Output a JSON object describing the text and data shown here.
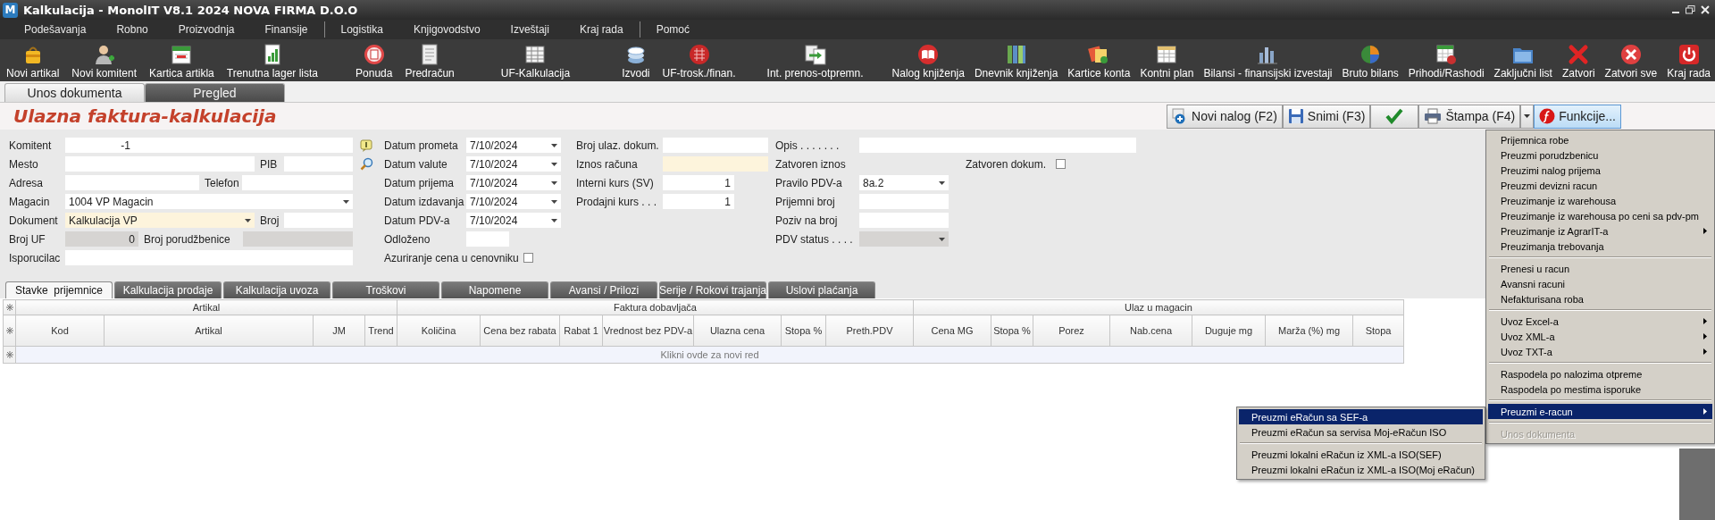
{
  "window": {
    "logo_text": "M",
    "title": "Kalkulacija - MonolIT V8.1 2024 NOVA FIRMA D.O.O"
  },
  "menu_groups": [
    [
      "Podešavanja",
      "Robno",
      "Proizvodnja",
      "Finansije"
    ],
    [
      "Logistika",
      "Knjigovodstvo",
      "Izveštaji",
      "Kraj rada"
    ],
    [
      "Pomoć"
    ]
  ],
  "toolbar": [
    "Novi artikal",
    "Novi komitent",
    "Kartica artikla",
    "Trenutna lager lista",
    "Ponuda",
    "Predračun",
    "UF-Kalkulacija",
    "Izvodi",
    "UF-trosk./finan.",
    "Int. prenos-otpremn.",
    "Nalog knjiženja",
    "Dnevnik knjiženja",
    "Kartice konta",
    "Kontni plan",
    "Bilansi - finansijski izvestaji",
    "Bruto bilans",
    "Prihodi/Rashodi",
    "Zaključni list",
    "Zatvori",
    "Zatvori sve",
    "Kraj rada"
  ],
  "main_tabs": [
    {
      "label": "Unos dokumenta",
      "selected": true
    },
    {
      "label": "Pregled",
      "selected": false
    }
  ],
  "page_title": "Ulazna faktura-kalkulacija",
  "actions": [
    {
      "kind": "plus",
      "label": "Novi nalog (F2)",
      "pressed": false
    },
    {
      "kind": "save",
      "label": "Snimi (F3)",
      "pressed": false
    },
    {
      "kind": "check",
      "pressed": false
    },
    {
      "kind": "print",
      "label": "Štampa (F4)",
      "pressed": false
    },
    {
      "kind": "dropdown",
      "pressed": false
    },
    {
      "kind": "function",
      "label": "Funkcije...",
      "pressed": true
    }
  ],
  "form": {
    "columns": [
      {
        "rows": [
          {
            "fields": [
              {
                "kind": "label",
                "text": "Komitent"
              },
              {
                "kind": "number",
                "value": "-1",
                "disabled": false,
                "highlighted": false
              },
              {
                "kind": "text",
                "disabled": false,
                "highlighted": false
              }
            ]
          },
          {
            "fields": [
              {
                "kind": "label",
                "text": "Mesto"
              },
              {
                "kind": "text",
                "disabled": false,
                "highlighted": false
              },
              {
                "kind": "label",
                "text": "PIB"
              },
              {
                "kind": "text",
                "disabled": false,
                "highlighted": false
              }
            ]
          },
          {
            "fields": [
              {
                "kind": "label",
                "text": "Adresa"
              },
              {
                "kind": "text",
                "disabled": false,
                "highlighted": false
              },
              {
                "kind": "label",
                "text": "Telefon"
              },
              {
                "kind": "text",
                "disabled": false,
                "highlighted": false
              }
            ]
          },
          {
            "fields": [
              {
                "kind": "label",
                "text": "Magacin"
              },
              {
                "kind": "select",
                "value": "1004 VP Magacin",
                "disabled": false,
                "highlighted": false
              }
            ]
          },
          {
            "fields": [
              {
                "kind": "label",
                "text": "Dokument"
              },
              {
                "kind": "select",
                "value": "Kalkulacija VP",
                "disabled": false,
                "highlighted": true
              },
              {
                "kind": "label",
                "text": "Broj"
              },
              {
                "kind": "text",
                "disabled": false,
                "highlighted": false
              }
            ]
          },
          {
            "fields": [
              {
                "kind": "label",
                "text": "Broj UF"
              },
              {
                "kind": "number",
                "value": "0",
                "disabled": true,
                "highlighted": false
              },
              {
                "kind": "label",
                "text": "Broj porudžbenice"
              },
              {
                "kind": "text",
                "disabled": true,
                "highlighted": false
              }
            ]
          },
          {
            "fields": [
              {
                "kind": "label",
                "text": "Isporucilac"
              },
              {
                "kind": "text",
                "disabled": false,
                "highlighted": false
              },
              {
                "kind": "text",
                "disabled": false,
                "highlighted": false
              }
            ]
          }
        ]
      },
      {
        "rows": [
          {
            "fields": [
              {
                "kind": "label",
                "text": "Datum prometa"
              },
              {
                "kind": "select",
                "value": "7/10/2024",
                "disabled": false,
                "highlighted": false
              }
            ]
          },
          {
            "fields": [
              {
                "kind": "label",
                "text": "Datum valute"
              },
              {
                "kind": "select",
                "value": "7/10/2024",
                "disabled": false,
                "highlighted": false
              }
            ]
          },
          {
            "fields": [
              {
                "kind": "label",
                "text": "Datum prijema"
              },
              {
                "kind": "select",
                "value": "7/10/2024",
                "disabled": false,
                "highlighted": false
              }
            ]
          },
          {
            "fields": [
              {
                "kind": "label",
                "text": "Datum izdavanja"
              },
              {
                "kind": "select",
                "value": "7/10/2024",
                "disabled": false,
                "highlighted": false
              }
            ]
          },
          {
            "fields": [
              {
                "kind": "label",
                "text": "Datum PDV-a"
              },
              {
                "kind": "select",
                "value": "7/10/2024",
                "disabled": false,
                "highlighted": false
              }
            ]
          },
          {
            "fields": [
              {
                "kind": "label",
                "text": "Odloženo"
              },
              {
                "kind": "text",
                "disabled": false,
                "highlighted": false
              }
            ]
          },
          {
            "fields": [
              {
                "kind": "label",
                "text": "Azuriranje cena u cenovniku"
              },
              {
                "kind": "checkbox",
                "checked": false
              }
            ]
          }
        ]
      },
      {
        "rows": [
          {
            "fields": [
              {
                "kind": "label",
                "text": "Broj ulaz. dokum."
              },
              {
                "kind": "text",
                "disabled": false,
                "highlighted": false
              }
            ]
          },
          {
            "fields": [
              {
                "kind": "label",
                "text": "Iznos računa"
              },
              {
                "kind": "text",
                "disabled": false,
                "highlighted": true
              }
            ]
          },
          {
            "fields": [
              {
                "kind": "label",
                "text": "Interni kurs (SV)"
              },
              {
                "kind": "number",
                "value": "1",
                "disabled": false,
                "highlighted": false
              }
            ]
          },
          {
            "fields": [
              {
                "kind": "label",
                "text": "Prodajni kurs . . ."
              },
              {
                "kind": "number",
                "value": "1",
                "disabled": false,
                "highlighted": false
              }
            ]
          }
        ]
      },
      {
        "rows": [
          {
            "fields": [
              {
                "kind": "label",
                "text": "Opis . . . . . . ."
              },
              {
                "kind": "text",
                "disabled": false,
                "highlighted": false
              }
            ]
          },
          {
            "fields": [
              {
                "kind": "label",
                "text": "Zatvoren iznos"
              },
              {
                "kind": "label",
                "text": "Zatvoren dokum."
              },
              {
                "kind": "checkbox",
                "checked": false
              }
            ]
          },
          {
            "fields": [
              {
                "kind": "label",
                "text": "Pravilo PDV-a"
              },
              {
                "kind": "select",
                "value": "8a.2",
                "disabled": false,
                "highlighted": false
              }
            ]
          },
          {
            "fields": [
              {
                "kind": "label",
                "text": "Prijemni broj"
              },
              {
                "kind": "text",
                "disabled": false,
                "highlighted": false
              }
            ]
          },
          {
            "fields": [
              {
                "kind": "label",
                "text": "Poziv na broj"
              },
              {
                "kind": "text",
                "disabled": false,
                "highlighted": false
              }
            ]
          },
          {
            "fields": [
              {
                "kind": "label",
                "text": "PDV status . . . ."
              },
              {
                "kind": "select",
                "disabled": true,
                "highlighted": false
              }
            ]
          }
        ]
      }
    ]
  },
  "detail_tabs": [
    {
      "label": "Stavke  prijemnice",
      "selected": true
    },
    {
      "label": "Kalkulacija prodaje",
      "selected": false
    },
    {
      "label": "Kalkulacija uvoza",
      "selected": false
    },
    {
      "label": "Troškovi",
      "selected": false
    },
    {
      "label": "Napomene",
      "selected": false
    },
    {
      "label": "Avansi / Prilozi",
      "selected": false
    },
    {
      "label": "Serije / Rokovi trajanja",
      "selected": false
    },
    {
      "label": "Uslovi plaćanja",
      "selected": false
    }
  ],
  "grid": {
    "groups": [
      {
        "label": "Artikal",
        "columns": [
          "Kod",
          "Artikal",
          "JM",
          "Trend"
        ]
      },
      {
        "label": "Faktura dobavljača",
        "columns": [
          "Količina",
          "Cena bez rabata",
          "Rabat 1",
          "Vrednost bez PDV-a",
          "Ulazna cena",
          "Stopa %",
          "Preth.PDV"
        ]
      },
      {
        "label": "Ulaz u magacin",
        "columns": [
          "Cena MG",
          "Stopa %",
          "Porez",
          "Nab.cena",
          "Duguje mg",
          "Marža (%) mg",
          "Stopa"
        ]
      }
    ],
    "new_row_hint": "Klikni ovde za novi red"
  },
  "functions_menu": {
    "items": [
      {
        "kind": "item",
        "label": "Prijemnica robe",
        "has_submenu": false,
        "selected": false,
        "disabled": false
      },
      {
        "kind": "item",
        "label": "Preuzmi porudzbenicu",
        "has_submenu": false,
        "selected": false,
        "disabled": false
      },
      {
        "kind": "item",
        "label": "Preuzimi nalog prijema",
        "has_submenu": false,
        "selected": false,
        "disabled": false
      },
      {
        "kind": "item",
        "label": "Preuzmi devizni racun",
        "has_submenu": false,
        "selected": false,
        "disabled": false
      },
      {
        "kind": "item",
        "label": "Preuzimanje iz warehousa",
        "has_submenu": false,
        "selected": false,
        "disabled": false
      },
      {
        "kind": "item",
        "label": "Preuzimanje iz warehousa po ceni sa pdv-pm",
        "has_submenu": false,
        "selected": false,
        "disabled": false
      },
      {
        "kind": "item",
        "label": "Preuzimanje iz AgrarIT-a",
        "has_submenu": true,
        "selected": false,
        "disabled": false
      },
      {
        "kind": "item",
        "label": "Preuzimanja trebovanja",
        "has_submenu": false,
        "selected": false,
        "disabled": false
      },
      {
        "kind": "separator"
      },
      {
        "kind": "item",
        "label": "Prenesi u racun",
        "has_submenu": false,
        "selected": false,
        "disabled": false
      },
      {
        "kind": "item",
        "label": "Avansni racuni",
        "has_submenu": false,
        "selected": false,
        "disabled": false
      },
      {
        "kind": "item",
        "label": "Nefakturisana roba",
        "has_submenu": false,
        "selected": false,
        "disabled": false
      },
      {
        "kind": "separator"
      },
      {
        "kind": "item",
        "label": "Uvoz Excel-a",
        "has_submenu": true,
        "selected": false,
        "disabled": false
      },
      {
        "kind": "item",
        "label": "Uvoz XML-a",
        "has_submenu": true,
        "selected": false,
        "disabled": false
      },
      {
        "kind": "item",
        "label": "Uvoz TXT-a",
        "has_submenu": true,
        "selected": false,
        "disabled": false
      },
      {
        "kind": "separator"
      },
      {
        "kind": "item",
        "label": "Raspodela po nalozima otpreme",
        "has_submenu": false,
        "selected": false,
        "disabled": false
      },
      {
        "kind": "item",
        "label": "Raspodela po mestima isporuke",
        "has_submenu": false,
        "selected": false,
        "disabled": false
      },
      {
        "kind": "separator"
      },
      {
        "kind": "item",
        "label": "Preuzmi e-racun",
        "has_submenu": true,
        "selected": true,
        "disabled": false
      },
      {
        "kind": "separator"
      },
      {
        "kind": "item",
        "label": "Unos dokumenta",
        "has_submenu": false,
        "selected": false,
        "disabled": true
      }
    ]
  },
  "e_invoice_submenu": {
    "items": [
      {
        "kind": "item",
        "label": "Preuzmi eRačun sa SEF-a",
        "has_submenu": false,
        "selected": true,
        "disabled": false
      },
      {
        "kind": "item",
        "label": "Preuzmi eRačun sa servisa Moj-eRačun ISO",
        "has_submenu": false,
        "selected": false,
        "disabled": false
      },
      {
        "kind": "separator"
      },
      {
        "kind": "item",
        "label": "Preuzmi lokalni eRačun iz XML-a ISO(SEF)",
        "has_submenu": false,
        "selected": false,
        "disabled": false
      },
      {
        "kind": "item",
        "label": "Preuzmi lokalni eRačun iz XML-a ISO(Moj eRačun)",
        "has_submenu": false,
        "selected": false,
        "disabled": false
      }
    ]
  }
}
